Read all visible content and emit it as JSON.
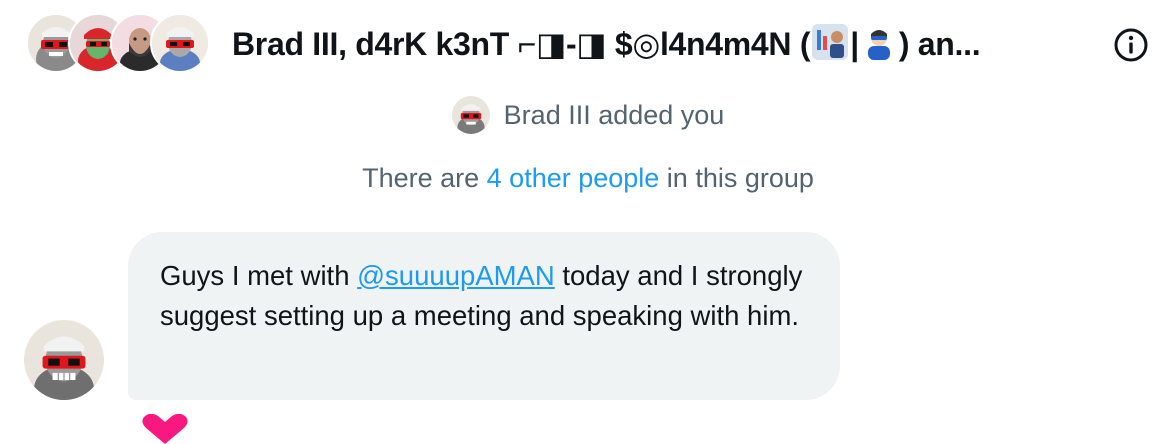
{
  "header": {
    "title_prefix": "Brad III, d4rK k3nT ⌐◨-◨ $◎l4n4m4N (",
    "title_separator": "|",
    "title_suffix": ") an...",
    "title_emoji_1": "man-office-worker-with-chart-emoji",
    "title_emoji_2": "superhero-emoji",
    "avatars": [
      {
        "name": "avatar-1",
        "bg": "#e9e4dc"
      },
      {
        "name": "avatar-2",
        "bg": "#e7d7d9"
      },
      {
        "name": "avatar-3",
        "bg": "#f3dde2"
      },
      {
        "name": "avatar-4",
        "bg": "#dbe3ee"
      }
    ],
    "info_icon": "info-circle-icon"
  },
  "system": {
    "added_text": "Brad III added you",
    "others_prefix": "There are ",
    "others_link": "4 other people",
    "others_suffix": " in this group"
  },
  "message": {
    "text_before": "Guys I met with ",
    "mention": "@suuuupAMAN",
    "text_after": " today and I strongly suggest setting up a meeting and speaking with him.",
    "reaction_icon": "heart-icon"
  },
  "colors": {
    "accent": "#1d9bf0",
    "muted_text": "#536471",
    "bubble_bg": "#eff3f4",
    "heart": "#f91880"
  }
}
